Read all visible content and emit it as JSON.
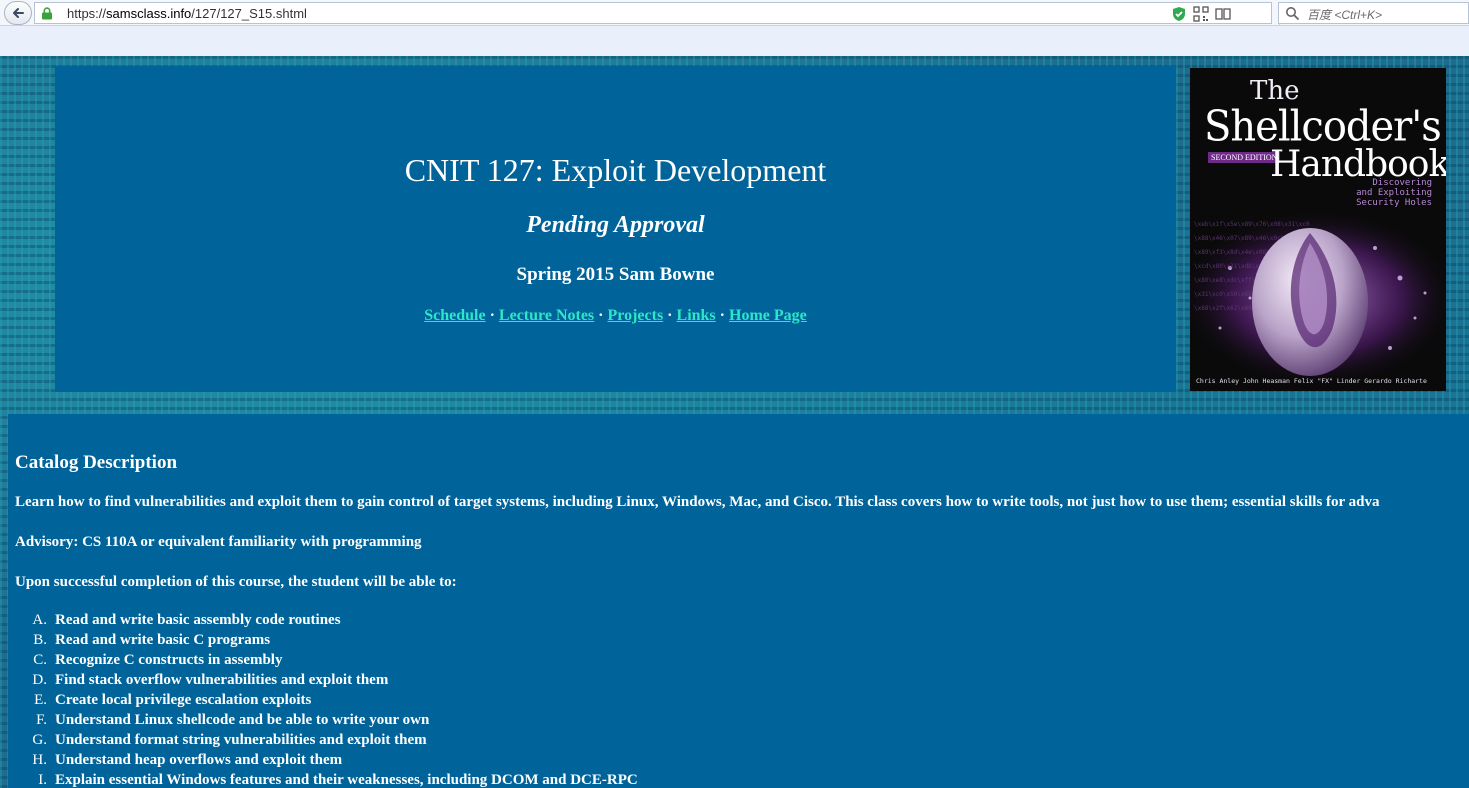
{
  "browser": {
    "url_scheme": "https://",
    "url_host": "samsclass.info",
    "url_path": "/127/127_S15.shtml",
    "search_placeholder": "百度 <Ctrl+K>"
  },
  "header": {
    "title": "CNIT 127: Exploit Development",
    "status": "Pending Approval",
    "term": "Spring 2015 Sam Bowne",
    "nav": [
      "Schedule",
      "Lecture Notes",
      "Projects",
      "Links",
      "Home Page"
    ],
    "separator": "·"
  },
  "book": {
    "the": "The",
    "title_line1": "Shellcoder's",
    "title_line2": "Handbook",
    "edition": "SECOND EDITION",
    "subtitle": "Discovering\nand Exploiting\nSecurity Holes",
    "authors": "Chris Anley  John Heasman  Felix \"FX\" Linder  Gerardo Richarte"
  },
  "main": {
    "heading": "Catalog Description",
    "description": "Learn how to find vulnerabilities and exploit them to gain control of target systems, including Linux, Windows, Mac, and Cisco. This class covers how to write tools, not just how to use them; essential skills for adva",
    "advisory": "Advisory: CS 110A or equivalent familiarity with programming",
    "outcomes_intro": "Upon successful completion of this course, the student will be able to:",
    "outcomes": [
      {
        "marker": "A.",
        "text": "Read and write basic assembly code routines"
      },
      {
        "marker": "B.",
        "text": "Read and write basic C programs"
      },
      {
        "marker": "C.",
        "text": "Recognize C constructs in assembly"
      },
      {
        "marker": "D.",
        "text": "Find stack overflow vulnerabilities and exploit them"
      },
      {
        "marker": "E.",
        "text": "Create local privilege escalation exploits"
      },
      {
        "marker": "F.",
        "text": "Understand Linux shellcode and be able to write your own"
      },
      {
        "marker": "G.",
        "text": "Understand format string vulnerabilities and exploit them"
      },
      {
        "marker": "H.",
        "text": "Understand heap overflows and exploit them"
      },
      {
        "marker": "I.",
        "text": "Explain essential Windows features and their weaknesses, including DCOM and DCE-RPC"
      }
    ]
  },
  "colors": {
    "panel_bg": "#00639a",
    "link": "#2ee6c9",
    "text": "#ffffff"
  }
}
